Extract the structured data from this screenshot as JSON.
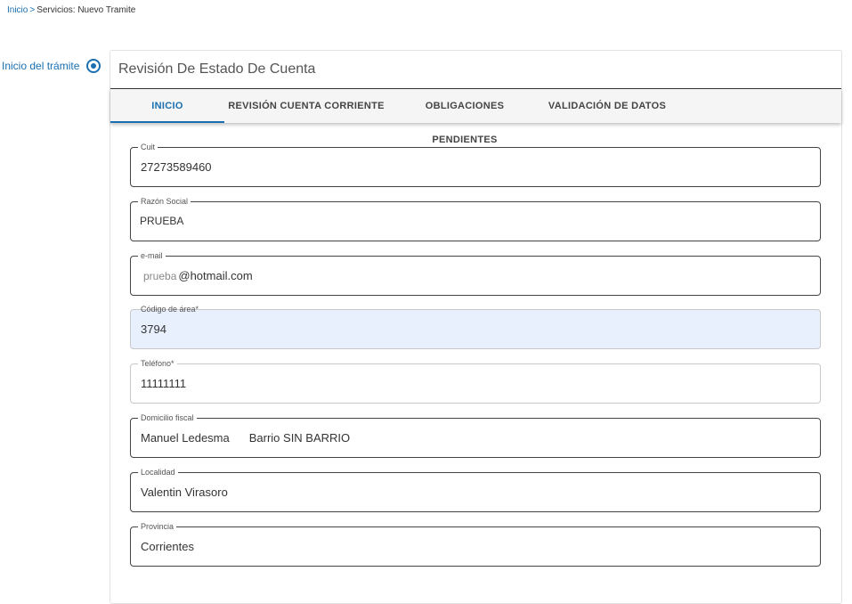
{
  "breadcrumb": {
    "home": "Inicio",
    "separator": ">",
    "current": "Servicios: Nuevo Tramite"
  },
  "step": {
    "label": "Inicio del trámite",
    "icon": "radio-selected-icon"
  },
  "card": {
    "title": "Revisión De Estado De Cuenta"
  },
  "tabs": [
    {
      "label": "INICIO",
      "active": true
    },
    {
      "label": "REVISIÓN CUENTA CORRIENTE",
      "active": false
    },
    {
      "label": "OBLIGACIONES PENDIENTES",
      "active": false
    },
    {
      "label": "VALIDACIÓN DE DATOS",
      "active": false
    }
  ],
  "fields": {
    "cuit": {
      "label": "Cuit",
      "value": "27273589460"
    },
    "razon_social": {
      "label": "Razón Social",
      "value": "PRUEBA"
    },
    "email": {
      "label": "e-mail",
      "prefix": "prueba",
      "value": "@hotmail.com"
    },
    "codigo_area": {
      "label": "Código de área*",
      "value": "3794"
    },
    "telefono": {
      "label": "Teléfono*",
      "value": "11111111"
    },
    "domicilio": {
      "label": "Domicilio fiscal",
      "value_a": "Manuel Ledesma",
      "value_b": "Barrio SIN BARRIO"
    },
    "localidad": {
      "label": "Localidad",
      "value": "Valentin Virasoro"
    },
    "provincia": {
      "label": "Provincia",
      "value": "Corrientes"
    }
  },
  "colors": {
    "accent": "#1a6fb0",
    "autofill": "#e8f0fe"
  }
}
